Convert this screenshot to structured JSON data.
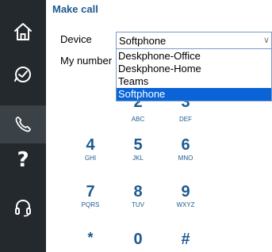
{
  "sidebar": {
    "items": [
      {
        "icon": "home-icon"
      },
      {
        "icon": "history-icon"
      },
      {
        "icon": "phone-icon"
      },
      {
        "icon": "help-icon",
        "glyph": "?"
      },
      {
        "icon": "headset-icon"
      }
    ]
  },
  "panel": {
    "title": "Make call",
    "device_label": "Device",
    "my_number_label": "My number"
  },
  "device_select": {
    "value": "Softphone",
    "options": [
      "Deskphone-Office",
      "Deskphone-Home",
      "Teams",
      "Softphone"
    ],
    "selected_index": 3
  },
  "keypad": [
    {
      "digit": "2",
      "letters": "ABC"
    },
    {
      "digit": "3",
      "letters": "DEF"
    },
    {
      "digit": "4",
      "letters": "GHI"
    },
    {
      "digit": "5",
      "letters": "JKL"
    },
    {
      "digit": "6",
      "letters": "MNO"
    },
    {
      "digit": "7",
      "letters": "PQRS"
    },
    {
      "digit": "8",
      "letters": "TUV"
    },
    {
      "digit": "9",
      "letters": "WXYZ"
    },
    {
      "digit": "*",
      "letters": ""
    },
    {
      "digit": "0",
      "letters": ""
    },
    {
      "digit": "#",
      "letters": ""
    }
  ],
  "colors": {
    "accent": "#1e5a8e",
    "sidebar": "#24292d",
    "selection": "#0a64d8"
  }
}
